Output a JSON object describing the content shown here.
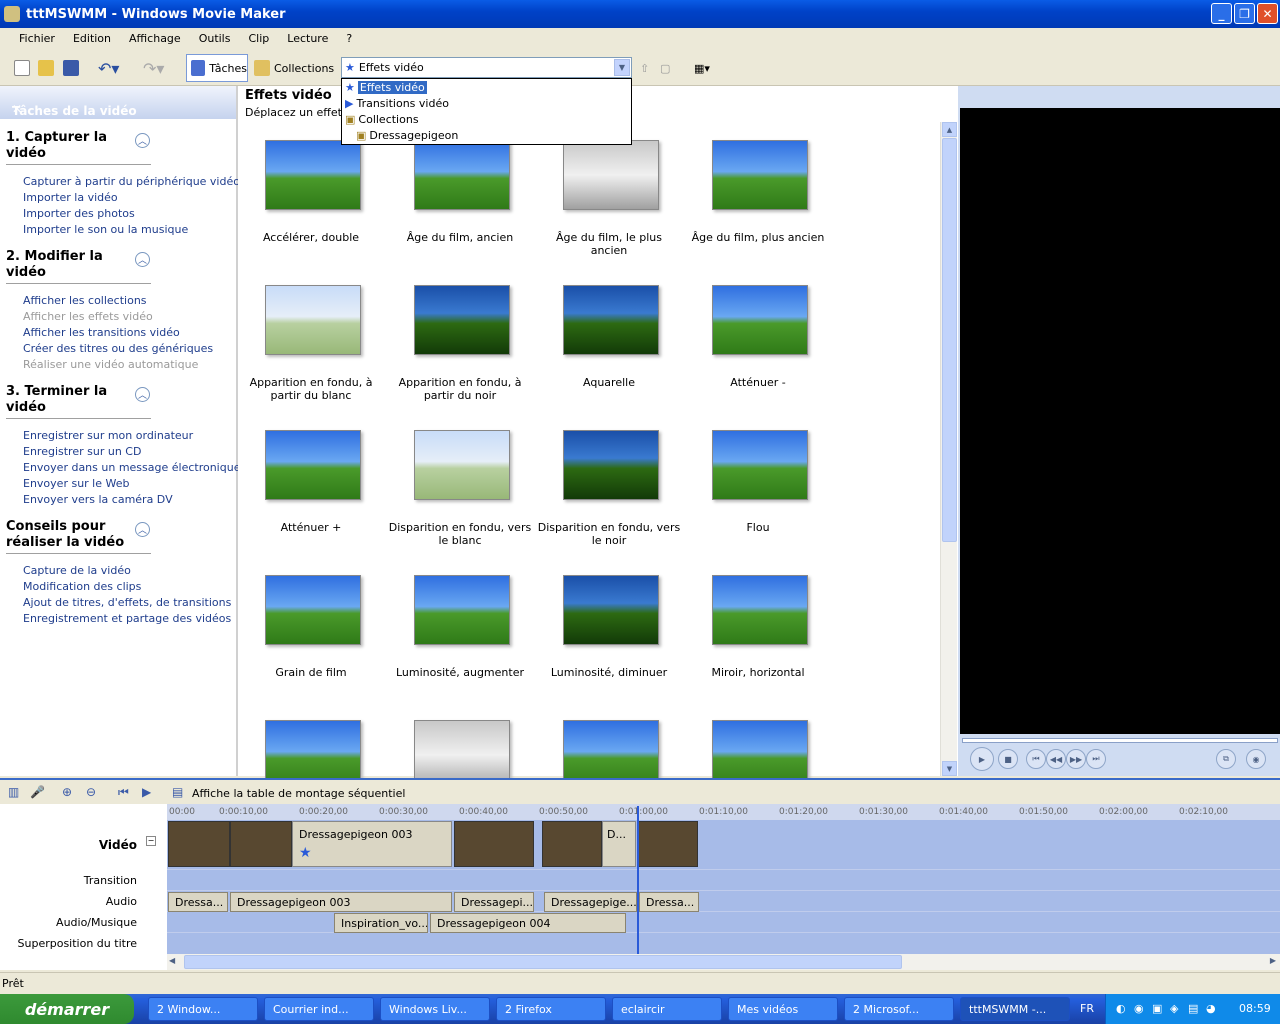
{
  "window": {
    "title": "tttMSWMM - Windows Movie Maker"
  },
  "menu": [
    "Fichier",
    "Edition",
    "Affichage",
    "Outils",
    "Clip",
    "Lecture",
    "?"
  ],
  "toolbar": {
    "taches": "Tâches",
    "collections": "Collections",
    "combo_value": "Effets vidéo"
  },
  "dropdown": [
    {
      "label": "Effets vidéo",
      "selected": true
    },
    {
      "label": "Transitions vidéo"
    },
    {
      "label": "Collections"
    },
    {
      "label": "Dressagepigeon"
    }
  ],
  "tasks": {
    "title": "Tâches de la vidéo",
    "sections": [
      {
        "title": "1. Capturer la vidéo",
        "items": [
          "Capturer à partir du périphérique vidéo",
          "Importer la vidéo",
          "Importer des photos",
          "Importer le son ou la musique"
        ]
      },
      {
        "title": "2. Modifier la vidéo",
        "items": [
          "Afficher les collections",
          "Afficher les effets vidéo",
          "Afficher les transitions vidéo",
          "Créer des titres ou des génériques",
          "Réaliser une vidéo automatique"
        ]
      },
      {
        "title": "3. Terminer la vidéo",
        "items": [
          "Enregistrer sur mon ordinateur",
          "Enregistrer sur un CD",
          "Envoyer dans un message électronique",
          "Envoyer sur le Web",
          "Envoyer vers la caméra DV"
        ]
      },
      {
        "title": "Conseils pour réaliser la vidéo",
        "items": [
          "Capture de la vidéo",
          "Modification des clips",
          "Ajout de titres, d'effets, de transitions",
          "Enregistrement et partage des vidéos"
        ]
      }
    ]
  },
  "content": {
    "heading": "Effets vidéo",
    "subheading": "Déplacez un effet vi",
    "effects": [
      "Accélérer, double",
      "Âge du film, ancien",
      "Âge du film, le plus ancien",
      "Âge du film, plus ancien",
      "Apparition en fondu, à partir du blanc",
      "Apparition en fondu, à partir du noir",
      "Aquarelle",
      "Atténuer -",
      "Atténuer +",
      "Disparition en fondu, vers le blanc",
      "Disparition en fondu, vers le noir",
      "Flou",
      "Grain de film",
      "Luminosité, augmenter",
      "Luminosité, diminuer",
      "Miroir, horizontal",
      "",
      "",
      "",
      ""
    ]
  },
  "timeline": {
    "toolbar_label": "Affiche la table de montage séquentiel",
    "ruler": [
      "00:00",
      "0:00:10,00",
      "0:00:20,00",
      "0:00:30,00",
      "0:00:40,00",
      "0:00:50,00",
      "0:01:00,00",
      "0:01:10,00",
      "0:01:20,00",
      "0:01:30,00",
      "0:01:40,00",
      "0:01:50,00",
      "0:02:00,00",
      "0:02:10,00"
    ],
    "tracks": [
      "Vidéo",
      "Transition",
      "Audio",
      "Audio/Musique",
      "Superposition du titre"
    ],
    "video_clips": [
      "Dressagepigeon 003",
      "D..."
    ],
    "audio_clips": [
      "Dressa...",
      "Dressagepigeon 003",
      "Dressagepi...",
      "Dressagepige...",
      "Dressa..."
    ],
    "music_clips": [
      "Inspiration_vo...",
      "Dressagepigeon 004"
    ]
  },
  "status": "Prêt",
  "taskbar": {
    "start": "démarrer",
    "items": [
      "2 Window...",
      "Courrier ind...",
      "Windows Liv...",
      "2 Firefox",
      "eclaircir",
      "Mes vidéos",
      "2 Microsof...",
      "tttMSWMM -..."
    ],
    "lang": "FR",
    "clock": "08:59"
  }
}
